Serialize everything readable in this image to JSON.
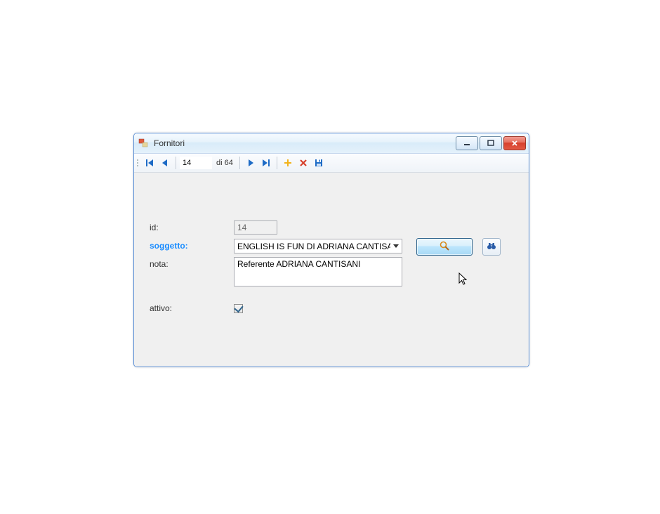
{
  "window": {
    "title": "Fornitori"
  },
  "navigator": {
    "current": "14",
    "total_label": "di 64"
  },
  "form": {
    "id_label": "id:",
    "id_value": "14",
    "soggetto_label": "soggetto:",
    "soggetto_value": "ENGLISH IS FUN DI ADRIANA CANTISANI",
    "nota_label": "nota:",
    "nota_value": "Referente ADRIANA CANTISANI",
    "attivo_label": "attivo:",
    "attivo_checked": true
  }
}
